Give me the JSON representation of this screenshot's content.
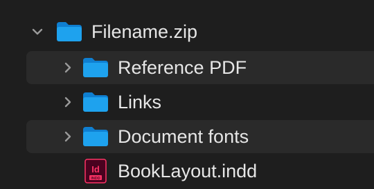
{
  "tree": {
    "root": {
      "name": "Filename.zip",
      "expanded": true,
      "icon": "folder-icon"
    },
    "children": [
      {
        "name": "Reference PDF",
        "icon": "folder-icon",
        "expanded": false
      },
      {
        "name": "Links",
        "icon": "folder-icon",
        "expanded": false
      },
      {
        "name": "Document fonts",
        "icon": "folder-icon",
        "expanded": false
      },
      {
        "name": "BookLayout.indd",
        "icon": "indesign-file-icon",
        "badge_text": "Id",
        "badge_subtext": "INDD"
      }
    ]
  },
  "colors": {
    "background": "#1e1e1e",
    "stripe": "#2a2a2a",
    "folder_front": "#1ea2ee",
    "folder_back": "#0f7fd1",
    "indd_bg": "#49021f",
    "indd_accent": "#ff3366",
    "text": "#e6e6e6"
  }
}
